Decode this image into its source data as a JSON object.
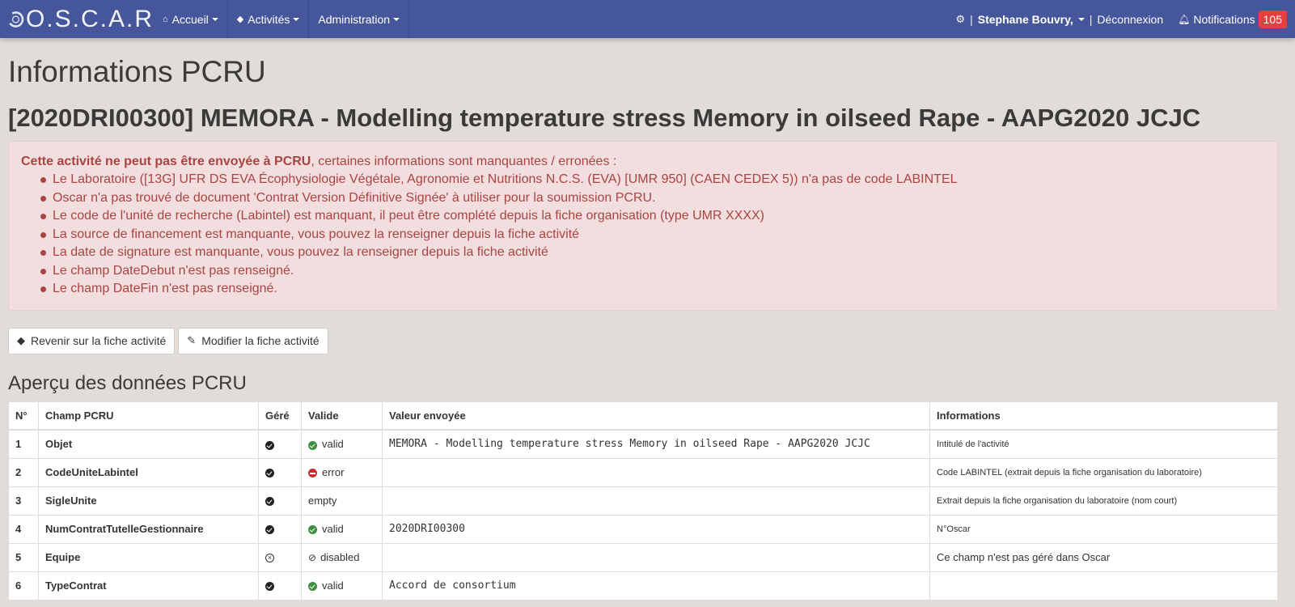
{
  "nav": {
    "brand": "O.S.C.A.R",
    "items": [
      {
        "label": "Accueil",
        "icon": "home-icon"
      },
      {
        "label": "Activités",
        "icon": "cube-icon"
      },
      {
        "label": "Administration"
      }
    ],
    "separator": "|",
    "user": "Stephane Bouvry,",
    "logout": "Déconnexion",
    "notifications_label": "Notifications",
    "notifications_count": "105"
  },
  "page": {
    "title": "Informations PCRU",
    "activity_title": "[2020DRI00300] MEMORA - Modelling temperature stress Memory in oilseed Rape - AAPG2020 JCJC"
  },
  "alert": {
    "lead_bold": "Cette activité ne peut pas être envoyée à PCRU",
    "lead_rest": ", certaines informations sont manquantes / erronées :",
    "items": [
      "Le Laboratoire ([13G] UFR DS EVA Écophysiologie Végétale, Agronomie et Nutritions N.C.S. (EVA) [UMR 950] (CAEN CEDEX 5)) n'a pas de code LABINTEL",
      "Oscar n'a pas trouvé de document 'Contrat Version Définitive Signée' à utiliser pour la soumission PCRU.",
      "Le code de l'unité de recherche (Labintel) est manquant, il peut être complété depuis la fiche organisation (type UMR XXXX)",
      "La source de financement est manquante, vous pouvez la renseigner depuis la fiche activité",
      "La date de signature est manquante, vous pouvez la renseigner depuis la fiche activité",
      "Le champ DateDebut n'est pas renseigné.",
      "Le champ DateFin n'est pas renseigné."
    ]
  },
  "buttons": {
    "back": "Revenir sur la fiche activité",
    "edit": "Modifier la fiche activité"
  },
  "section_title": "Aperçu des données PCRU",
  "table": {
    "headers": [
      "N°",
      "Champ PCRU",
      "Géré",
      "Valide",
      "Valeur envoyée",
      "Informations"
    ],
    "rows": [
      {
        "n": "1",
        "field": "Objet",
        "managed": true,
        "status": "valid",
        "value": "MEMORA - Modelling temperature stress Memory in oilseed Rape - AAPG2020 JCJC",
        "info": "Intitulé de l'activité"
      },
      {
        "n": "2",
        "field": "CodeUniteLabintel",
        "managed": true,
        "status": "error",
        "value": "",
        "info": "Code LABINTEL (extrait depuis la fiche organisation du laboratoire)"
      },
      {
        "n": "3",
        "field": "SigleUnite",
        "managed": true,
        "status": "empty",
        "value": "",
        "info": "Extrait depuis la fiche organisation du laboratoire (nom court)"
      },
      {
        "n": "4",
        "field": "NumContratTutelleGestionnaire",
        "managed": true,
        "status": "valid",
        "value": "2020DRI00300",
        "info": "N°Oscar"
      },
      {
        "n": "5",
        "field": "Equipe",
        "managed": false,
        "status": "disabled",
        "value": "",
        "info": "Ce champ n'est pas géré dans Oscar"
      },
      {
        "n": "6",
        "field": "TypeContrat",
        "managed": true,
        "status": "valid",
        "value": "Accord de consortium",
        "info": ""
      }
    ]
  }
}
